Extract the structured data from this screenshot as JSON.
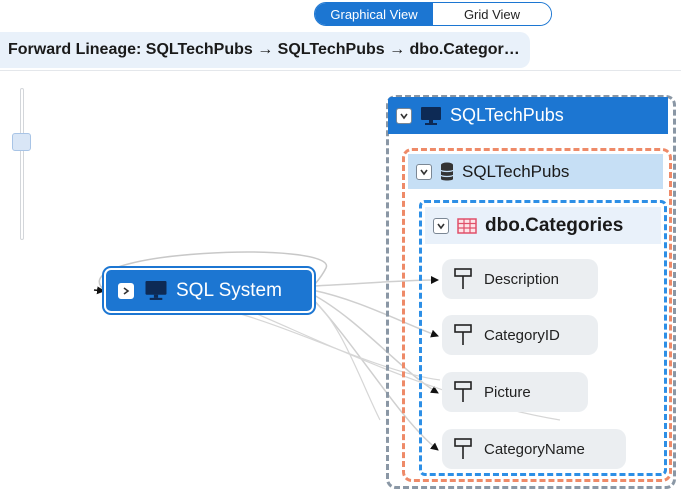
{
  "toggle": {
    "graphical": "Graphical View",
    "grid": "Grid View"
  },
  "breadcrumb": "Forward Lineage: SQLTechPubs → SQLTechPubs → dbo.Categor…",
  "source_node": {
    "label": "SQL System",
    "icon": "monitor-icon"
  },
  "server": {
    "label": "SQLTechPubs",
    "icon": "monitor-icon"
  },
  "database": {
    "label": "SQLTechPubs",
    "icon": "database-icon"
  },
  "table": {
    "label": "dbo.Categories",
    "icon": "table-icon"
  },
  "columns": [
    {
      "label": "Description"
    },
    {
      "label": "CategoryID"
    },
    {
      "label": "Picture"
    },
    {
      "label": "CategoryName"
    }
  ],
  "colors": {
    "accent": "#1c76d2",
    "server_border": "#8a97a5",
    "db_border": "#ee8a68",
    "table_border": "#2d8fe6",
    "table_icon": "#e0506a"
  }
}
